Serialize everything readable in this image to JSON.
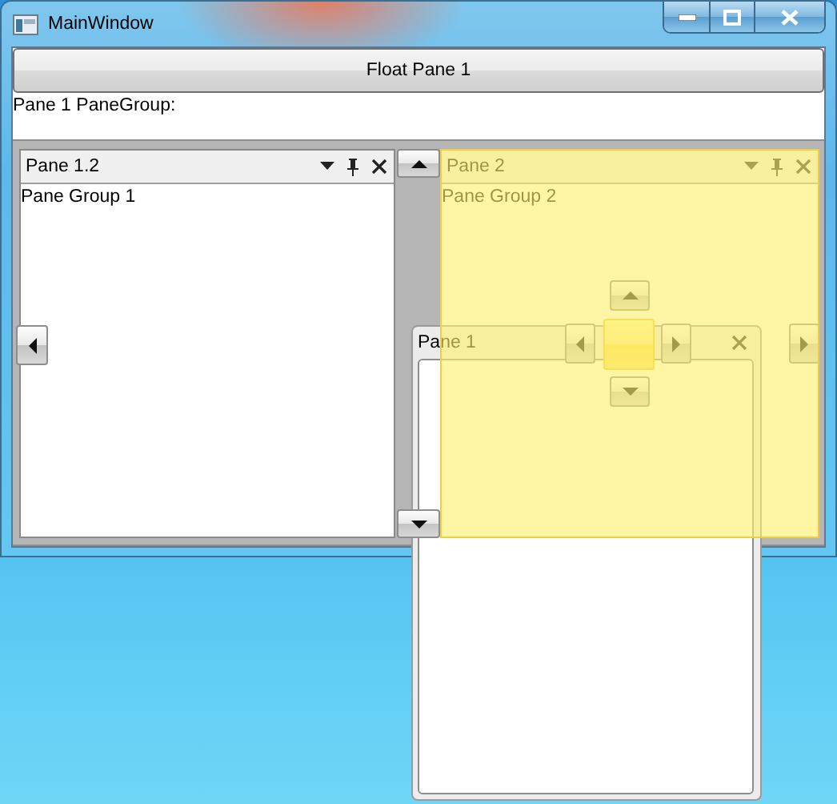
{
  "window": {
    "title": "MainWindow"
  },
  "float_button": {
    "label": "Float Pane 1"
  },
  "pane_group_label": "Pane 1 PaneGroup:",
  "pane_groups": [
    {
      "title": "Pane 1.2",
      "content": "Pane Group 1",
      "drop_preview": false
    },
    {
      "title": "Pane 2",
      "content": "Pane Group 2",
      "drop_preview": true
    }
  ],
  "floating_pane": {
    "title": "Pane 1"
  }
}
